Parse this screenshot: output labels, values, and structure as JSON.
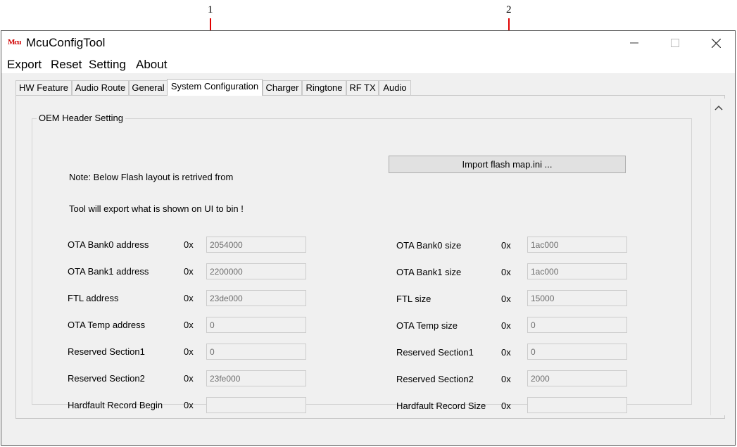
{
  "annotations": [
    {
      "number": "1",
      "color": "#e00000"
    },
    {
      "number": "2",
      "color": "#e00000"
    }
  ],
  "window": {
    "title": "McuConfigTool",
    "icon_name": "mcu-app-icon",
    "icon_text": "Mcu",
    "controls": {
      "minimize": "minimize-icon",
      "maximize": "maximize-icon",
      "close": "close-icon"
    }
  },
  "menu": [
    "Export",
    "Reset",
    "Setting",
    "About"
  ],
  "tabs": [
    "HW Feature",
    "Audio Route",
    "General",
    "System Configuration",
    "Charger",
    "Ringtone",
    "RF TX",
    "Audio"
  ],
  "active_tab": "System Configuration",
  "group": {
    "title": "OEM Header Setting",
    "note_line1": "Note: Below Flash layout is retrived  from",
    "note_line2": "Tool will export what is shown on UI to bin !",
    "import_button": "Import flash map.ini ...",
    "prefix": "0x",
    "left_fields": [
      {
        "label": "OTA Bank0 address",
        "value": "2054000"
      },
      {
        "label": "OTA Bank1 address",
        "value": "2200000"
      },
      {
        "label": "FTL address",
        "value": "23de000"
      },
      {
        "label": "OTA Temp address",
        "value": "0"
      },
      {
        "label": "Reserved Section1",
        "value": "0"
      },
      {
        "label": "Reserved Section2",
        "value": "23fe000"
      },
      {
        "label": "Hardfault Record Begin",
        "value": ""
      }
    ],
    "right_fields": [
      {
        "label": "OTA Bank0 size",
        "value": "1ac000"
      },
      {
        "label": "OTA Bank1 size",
        "value": "1ac000"
      },
      {
        "label": "FTL size",
        "value": "15000"
      },
      {
        "label": "OTA Temp size",
        "value": "0"
      },
      {
        "label": "Reserved Section1",
        "value": "0"
      },
      {
        "label": "Reserved Section2",
        "value": "2000"
      },
      {
        "label": "Hardfault Record Size",
        "value": ""
      }
    ]
  },
  "scrollbar": {
    "up_icon": "scroll-up-icon"
  }
}
